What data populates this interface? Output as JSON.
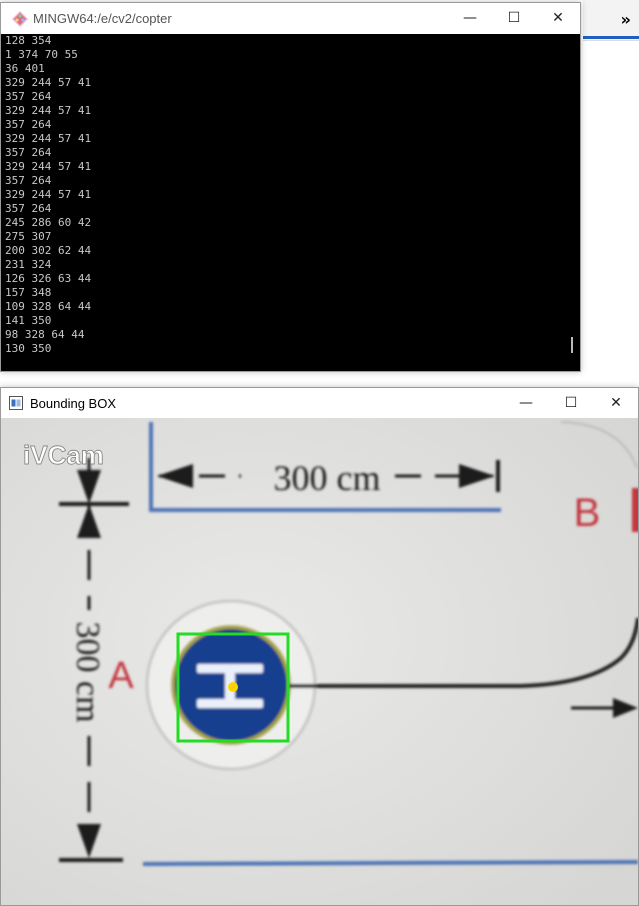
{
  "background_app": {
    "overflow_label": "»"
  },
  "terminal": {
    "title": "MINGW64:/e/cv2/copter",
    "controls": {
      "minimize": "—",
      "maximize": "☐",
      "close": "✕"
    },
    "lines": [
      "128 354",
      "1 374 70 55",
      "36 401",
      "329 244 57 41",
      "357 264",
      "329 244 57 41",
      "357 264",
      "329 244 57 41",
      "357 264",
      "329 244 57 41",
      "357 264",
      "329 244 57 41",
      "357 264",
      "245 286 60 42",
      "275 307",
      "200 302 62 44",
      "231 324",
      "126 326 63 44",
      "157 348",
      "109 328 64 44",
      "141 350",
      "98 328 64 44",
      "130 350"
    ]
  },
  "bbox_window": {
    "title": "Bounding BOX",
    "controls": {
      "minimize": "—",
      "maximize": "☐",
      "close": "✕"
    },
    "camera": {
      "watermark": "iVCam",
      "dimension_horizontal": "300 cm",
      "dimension_vertical": "300 cm",
      "label_a": "A",
      "label_b": "B",
      "helipad_letter": "H",
      "colors": {
        "box": "#22dd22",
        "center_dot": "#ffd400",
        "helipad": "#12408f",
        "labels": "#c2383f",
        "lines": "#4d73b5"
      }
    }
  }
}
